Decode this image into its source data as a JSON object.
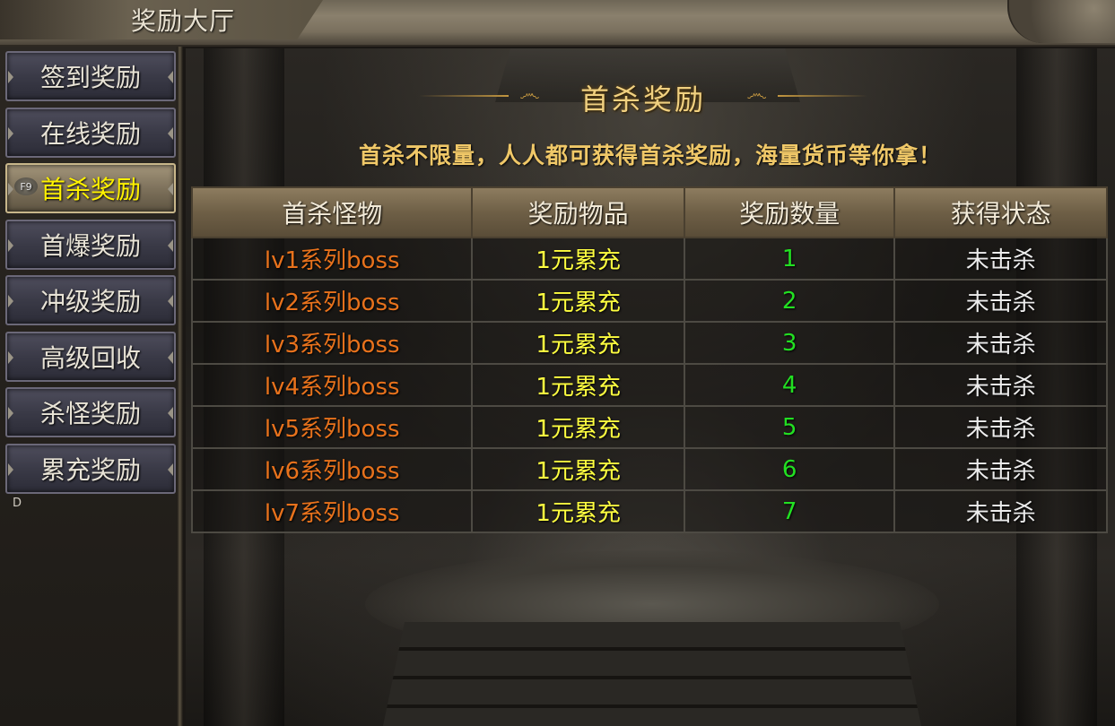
{
  "window": {
    "title": "奖励大厅"
  },
  "sidebar": {
    "items": [
      {
        "label": "签到奖励",
        "active": false
      },
      {
        "label": "在线奖励",
        "active": false
      },
      {
        "label": "首杀奖励",
        "active": true,
        "hotkey": "F9"
      },
      {
        "label": "首爆奖励",
        "active": false
      },
      {
        "label": "冲级奖励",
        "active": false
      },
      {
        "label": "高级回收",
        "active": false
      },
      {
        "label": "杀怪奖励",
        "active": false
      },
      {
        "label": "累充奖励",
        "active": false
      }
    ],
    "footer_hotkey": "D"
  },
  "main": {
    "heading": "首杀奖励",
    "subheading": "首杀不限量，人人都可获得首杀奖励，海量货币等你拿！",
    "table": {
      "headers": [
        "首杀怪物",
        "奖励物品",
        "奖励数量",
        "获得状态"
      ],
      "rows": [
        {
          "monster": "lv1系列boss",
          "item": "1元累充",
          "qty": "1",
          "status": "未击杀"
        },
        {
          "monster": "lv2系列boss",
          "item": "1元累充",
          "qty": "2",
          "status": "未击杀"
        },
        {
          "monster": "lv3系列boss",
          "item": "1元累充",
          "qty": "3",
          "status": "未击杀"
        },
        {
          "monster": "lv4系列boss",
          "item": "1元累充",
          "qty": "4",
          "status": "未击杀"
        },
        {
          "monster": "lv5系列boss",
          "item": "1元累充",
          "qty": "5",
          "status": "未击杀"
        },
        {
          "monster": "lv6系列boss",
          "item": "1元累充",
          "qty": "6",
          "status": "未击杀"
        },
        {
          "monster": "lv7系列boss",
          "item": "1元累充",
          "qty": "7",
          "status": "未击杀"
        }
      ]
    }
  },
  "colors": {
    "active_label": "#fff200",
    "monster_text": "#e8721c",
    "item_text": "#ffff40",
    "qty_text": "#22e022",
    "status_text": "#ececec",
    "heading_gold": "#f0d080"
  }
}
